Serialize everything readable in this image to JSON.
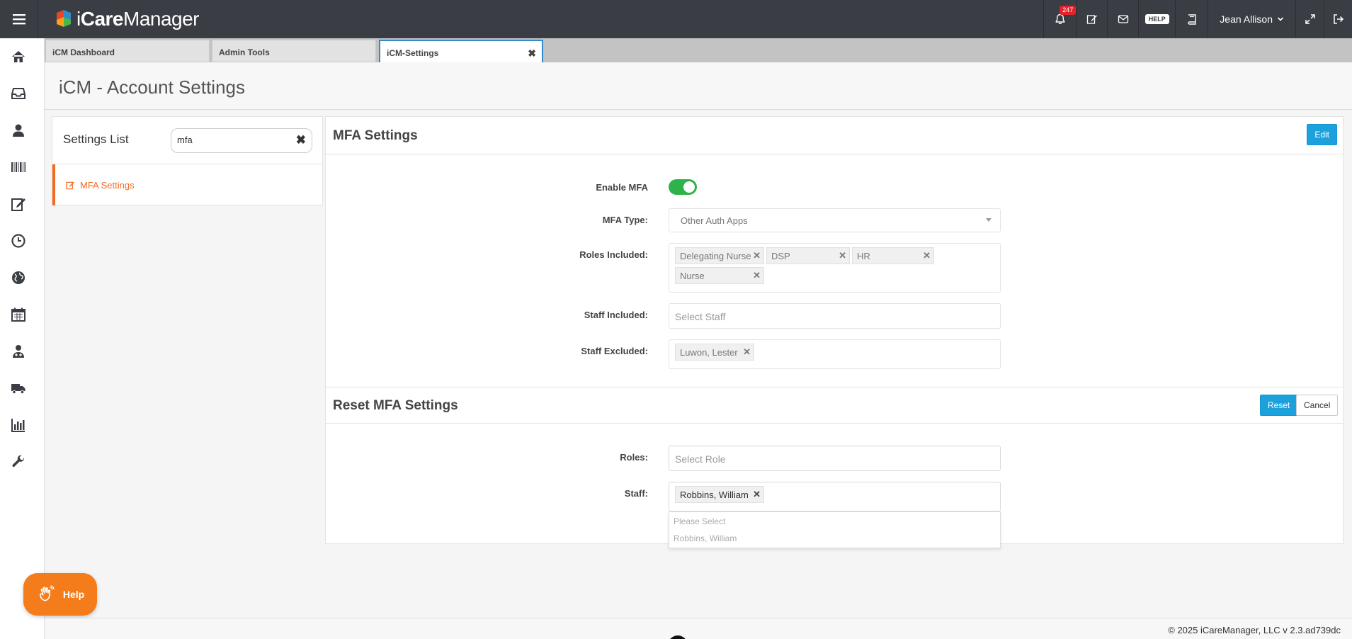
{
  "app": {
    "brand_prefix": "i",
    "brand_bold": "Care",
    "brand_rest": "Manager",
    "notification_count": "247",
    "help_label": "HELP",
    "user_name": "Jean Allison"
  },
  "sidebar": {
    "icons": [
      "home-icon",
      "inbox-icon",
      "user-icon",
      "barcode-icon",
      "edit-icon",
      "clock-icon",
      "globe-icon",
      "calendar-icon",
      "user-md-icon",
      "truck-icon",
      "bar-chart-icon",
      "wrench-icon"
    ]
  },
  "tabs": [
    {
      "label": "iCM Dashboard"
    },
    {
      "label": "Admin Tools"
    },
    {
      "label": "iCM-Settings"
    }
  ],
  "page": {
    "title": "iCM - Account Settings"
  },
  "settings_list": {
    "title": "Settings List",
    "search_value": "mfa",
    "items": [
      {
        "label": "MFA Settings"
      }
    ]
  },
  "mfa_settings": {
    "title": "MFA Settings",
    "edit_label": "Edit",
    "enable_mfa_label": "Enable MFA",
    "enable_mfa_value": true,
    "mfa_type_label": "MFA Type:",
    "mfa_type_value": "Other Auth Apps",
    "roles_included_label": "Roles Included:",
    "roles_included": [
      "Delegating Nurse",
      "DSP",
      "HR",
      "Nurse"
    ],
    "staff_included_label": "Staff Included:",
    "staff_included_placeholder": "Select Staff",
    "staff_excluded_label": "Staff Excluded:",
    "staff_excluded": [
      "Luwon, Lester"
    ]
  },
  "reset_mfa": {
    "title": "Reset MFA Settings",
    "reset_label": "Reset",
    "cancel_label": "Cancel",
    "roles_label": "Roles:",
    "roles_placeholder": "Select Role",
    "staff_label": "Staff:",
    "staff_selected": [
      "Robbins, William"
    ],
    "dropdown_options": [
      "Please Select",
      "Robbins, William"
    ]
  },
  "help_button": {
    "label": "Help"
  },
  "footer": {
    "text": "© 2025 iCareManager, LLC v 2.3.ad739dc"
  },
  "colors": {
    "topbar": "#3a3d44",
    "accent_orange": "#f36a22",
    "primary_blue": "#1da1dc",
    "toggle_green": "#2db34a",
    "badge_red": "#e0242e"
  }
}
